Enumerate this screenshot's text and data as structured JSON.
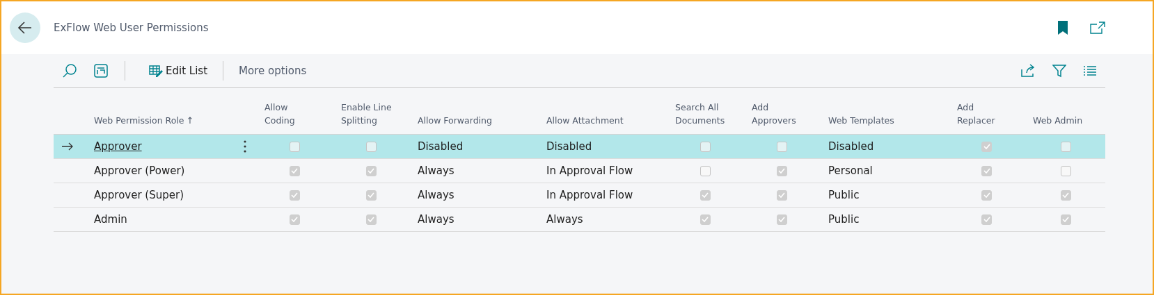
{
  "window": {
    "title": "ExFlow Web User Permissions"
  },
  "toolbar": {
    "actions": [
      {
        "kind": "search"
      },
      {
        "kind": "layout"
      },
      {
        "kind": "edit",
        "label": "Edit List"
      },
      {
        "kind": "more",
        "label": "More options"
      }
    ],
    "right_actions": [
      {
        "kind": "share"
      },
      {
        "kind": "filter"
      },
      {
        "kind": "list"
      }
    ]
  },
  "table": {
    "columns": [
      {
        "label": "Web Permission Role",
        "kind": "role",
        "sort_indicator": "↑"
      },
      {
        "label": "Allow Coding",
        "kind": "check"
      },
      {
        "label": "Enable Line Splitting",
        "kind": "check"
      },
      {
        "label": "Allow Forwarding",
        "kind": "text"
      },
      {
        "label": "Allow Attachment",
        "kind": "text"
      },
      {
        "label": "Search All Documents",
        "kind": "check"
      },
      {
        "label": "Add Approvers",
        "kind": "check"
      },
      {
        "label": "Web Templates",
        "kind": "text"
      },
      {
        "label": "Add Replacer",
        "kind": "check"
      },
      {
        "label": "Web Admin",
        "kind": "check"
      }
    ],
    "rows": [
      {
        "selected": true,
        "cells": [
          "Approver",
          false,
          false,
          "Disabled",
          "Disabled",
          false,
          false,
          "Disabled",
          true,
          false
        ]
      },
      {
        "selected": false,
        "cells": [
          "Approver (Power)",
          true,
          true,
          "Always",
          "In Approval Flow",
          false,
          true,
          "Personal",
          true,
          false
        ]
      },
      {
        "selected": false,
        "cells": [
          "Approver (Super)",
          true,
          true,
          "Always",
          "In Approval Flow",
          true,
          true,
          "Public",
          true,
          true
        ]
      },
      {
        "selected": false,
        "cells": [
          "Admin",
          true,
          true,
          "Always",
          "Always",
          true,
          true,
          "Public",
          true,
          true
        ]
      }
    ]
  }
}
